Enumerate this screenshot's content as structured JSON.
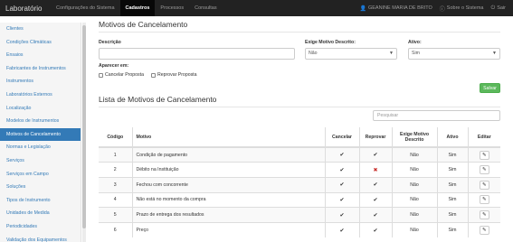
{
  "brand": "Laboratório",
  "topnav": [
    {
      "label": "Configurações do Sistema"
    },
    {
      "label": "Cadastros"
    },
    {
      "label": "Processos"
    },
    {
      "label": "Consultas"
    }
  ],
  "topright": {
    "user": "GEANINE MARIA DE BRITO",
    "about": "Sobre o Sistema",
    "exit": "Sair"
  },
  "sidebar": [
    {
      "label": "Clientes"
    },
    {
      "label": "Condições Climáticas"
    },
    {
      "label": "Ensaios"
    },
    {
      "label": "Fabricantes de Instrumentos"
    },
    {
      "label": "Instrumentos"
    },
    {
      "label": "Laboratórios Externos"
    },
    {
      "label": "Localização"
    },
    {
      "label": "Modelos de Instrumentos"
    },
    {
      "label": "Motivos de Cancelamento"
    },
    {
      "label": "Normas e Legislação"
    },
    {
      "label": "Serviços"
    },
    {
      "label": "Serviços em Campo"
    },
    {
      "label": "Soluções"
    },
    {
      "label": "Tipos de Instrumento"
    },
    {
      "label": "Unidades de Medida"
    },
    {
      "label": "Periodicidades"
    },
    {
      "label": "Validação dos Equipamentos"
    }
  ],
  "form": {
    "title": "Motivos de Cancelamento",
    "descricao_label": "Descrição",
    "descricao_value": "",
    "exige_label": "Exige Motivo Descrito:",
    "exige_value": "Não",
    "ativo_label": "Ativo:",
    "ativo_value": "Sim",
    "aparecer_label": "Aparecer em:",
    "check_cancelar": "Cancelar Proposta",
    "check_reprovar": "Reprovar Proposta",
    "save": "Salvar"
  },
  "list": {
    "title": "Lista de Motivos de Cancelamento",
    "search_placeholder": "Pesquisar",
    "headers": [
      "Código",
      "Motivo",
      "Cancelar",
      "Reprovar",
      "Exige Motivo Descrito",
      "Ativo",
      "Editar"
    ],
    "rows": [
      {
        "codigo": "1",
        "motivo": "Condição de pagamento",
        "cancelar": true,
        "reprovar": true,
        "exige": "Não",
        "ativo": "Sim"
      },
      {
        "codigo": "2",
        "motivo": "Débito na Instituição",
        "cancelar": true,
        "reprovar": false,
        "exige": "Não",
        "ativo": "Sim"
      },
      {
        "codigo": "3",
        "motivo": "Fechou com concorrente",
        "cancelar": true,
        "reprovar": true,
        "exige": "Não",
        "ativo": "Sim"
      },
      {
        "codigo": "4",
        "motivo": "Não está no momento da compra",
        "cancelar": true,
        "reprovar": true,
        "exige": "Não",
        "ativo": "Sim"
      },
      {
        "codigo": "5",
        "motivo": "Prazo de entrega dos resultados",
        "cancelar": true,
        "reprovar": true,
        "exige": "Não",
        "ativo": "Sim"
      },
      {
        "codigo": "6",
        "motivo": "Preço",
        "cancelar": true,
        "reprovar": true,
        "exige": "Não",
        "ativo": "Sim"
      }
    ],
    "icons": {
      "check": "check-icon",
      "cross": "cross-icon",
      "edit": "pencil-icon"
    }
  },
  "colors": {
    "primary": "#337ab7",
    "success": "#5cb85c",
    "danger": "#c9302c",
    "navbar": "#222222"
  }
}
